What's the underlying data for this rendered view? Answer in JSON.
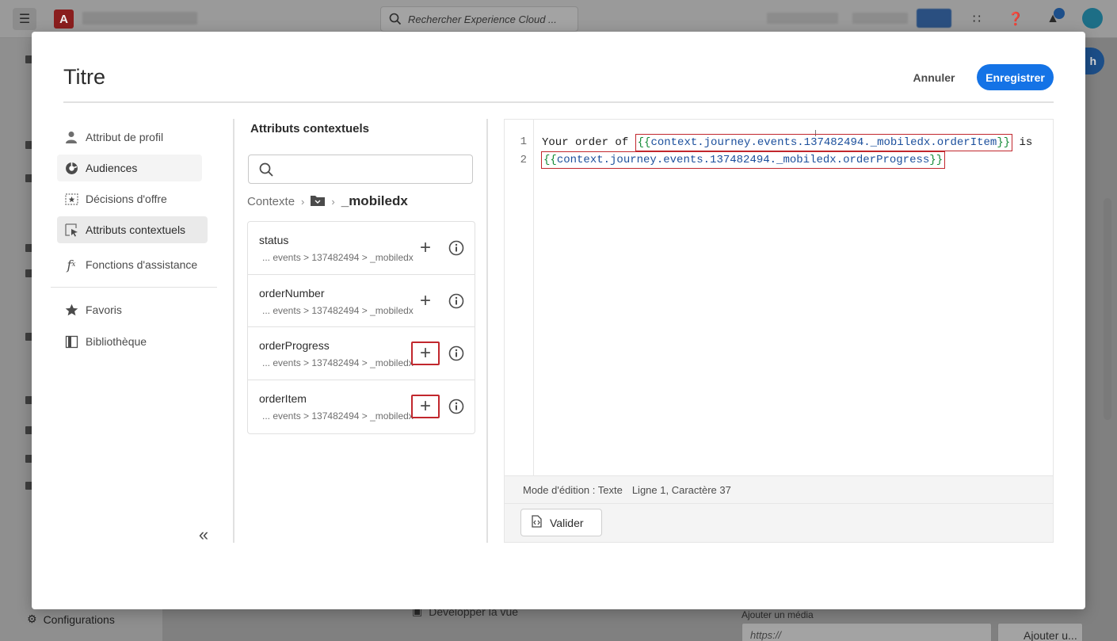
{
  "background": {
    "search_placeholder": "Rechercher Experience Cloud ...",
    "app_button_label": "h",
    "nav_configurations_label": "Configurations",
    "expand_view_label": "Développer la vue",
    "media_label": "Ajouter un média",
    "media_placeholder": "https://",
    "media_button_label": "Ajouter u..."
  },
  "modal": {
    "title": "Titre",
    "cancel_label": "Annuler",
    "save_label": "Enregistrer"
  },
  "nav": {
    "items": [
      {
        "label": "Attribut de profil",
        "icon": "person-icon"
      },
      {
        "label": "Audiences",
        "icon": "audiences-icon"
      },
      {
        "label": "Décisions d'offre",
        "icon": "offer-decision-icon"
      },
      {
        "label": "Attributs contextuels",
        "icon": "contextual-attribute-icon"
      },
      {
        "label": "Fonctions d'assistance",
        "icon": "function-fx-icon"
      },
      {
        "label": "Favoris",
        "icon": "star-icon"
      },
      {
        "label": "Bibliothèque",
        "icon": "library-icon"
      }
    ],
    "selected": "Attributs contextuels"
  },
  "attributes": {
    "heading": "Attributs contextuels",
    "search_value": "",
    "breadcrumb": {
      "root": "Contexte",
      "current": "_mobiledx"
    },
    "items": [
      {
        "name": "status",
        "path": "... events > 137482494 > _mobiledx"
      },
      {
        "name": "orderNumber",
        "path": "... events > 137482494 > _mobiledx"
      },
      {
        "name": "orderProgress",
        "path": "... events > 137482494 > _mobiledx"
      },
      {
        "name": "orderItem",
        "path": "... events > 137482494 > _mobiledx"
      }
    ]
  },
  "editor": {
    "line_numbers": [
      "1",
      "2"
    ],
    "line1_prefix": "Your order of ",
    "line1_token_open": "{{",
    "line1_token_body": "context.journey.events.137482494._mobiledx.orderItem",
    "line1_token_close": "}}",
    "line1_suffix": " is",
    "line2_token_open": "{{",
    "line2_token_body": "context.journey.events.137482494._mobiledx.orderProgress",
    "line2_token_close": "}}",
    "status_mode": "Mode d'édition : Texte",
    "status_position": "Ligne 1, Caractère 37",
    "validate_label": "Valider"
  },
  "colors": {
    "accent": "#1473e6",
    "token_border": "#c1272d",
    "token_text": "#1b4f9c",
    "token_brace": "#138a36"
  }
}
